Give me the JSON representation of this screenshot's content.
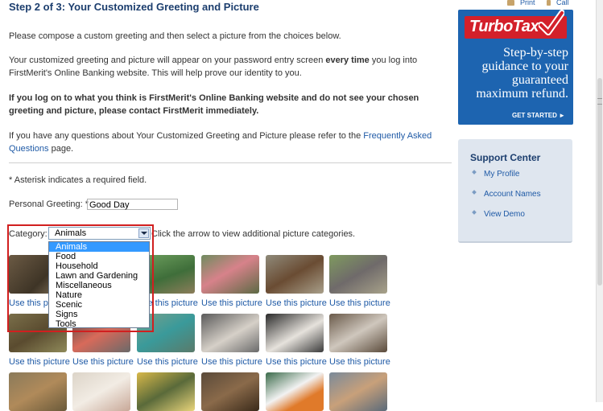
{
  "page": {
    "step_title": "Step 2 of 3: Your Customized Greeting and Picture",
    "intro": "Please compose a custom greeting and then select a picture from the choices below.",
    "explain_part1": "Your customized greeting and picture will appear on your password entry screen ",
    "explain_bold": "every time",
    "explain_part2": " you log into FirstMerit's Online Banking website. This will help prove our identity to you.",
    "warning": "If you log on to what you think is FirstMerit's Online Banking website and do not see your chosen greeting and picture, please contact FirstMerit immediately.",
    "questions_part1": "If you have any questions about Your Customized Greeting and Picture please refer to the ",
    "questions_link": "Frequently Asked Questions",
    "questions_part2": " page.",
    "required_note": "* Asterisk indicates a required field.",
    "greeting_label": "Personal Greeting: *",
    "greeting_value": "Good Day",
    "category_label": "Category:",
    "category_selected": "Animals",
    "category_hint": "Click the arrow to view additional picture categories.",
    "categories": [
      "Animals",
      "Food",
      "Household",
      "Lawn and Gardening",
      "Miscellaneous",
      "Nature",
      "Scenic",
      "Signs",
      "Tools"
    ],
    "use_picture_label": "Use this picture"
  },
  "sidebar": {
    "print_label": "Print",
    "call_label": "Call",
    "ad_logo": "TurboTax",
    "ad_line1": "Step-by-step",
    "ad_line2": "guidance to your",
    "ad_line3": "guaranteed",
    "ad_line4": "maximum refund.",
    "ad_cta": "GET STARTED ►",
    "support_title": "Support Center",
    "support_items": [
      "My Profile",
      "Account Names",
      "View Demo"
    ]
  },
  "colors": {
    "title_blue": "#1c3e6e",
    "link_blue": "#1f5aa6",
    "ad_blue": "#1d64b0",
    "ad_red": "#d3202a",
    "highlight_red": "#d11f1f",
    "dropdown_selected": "#3399ff"
  }
}
